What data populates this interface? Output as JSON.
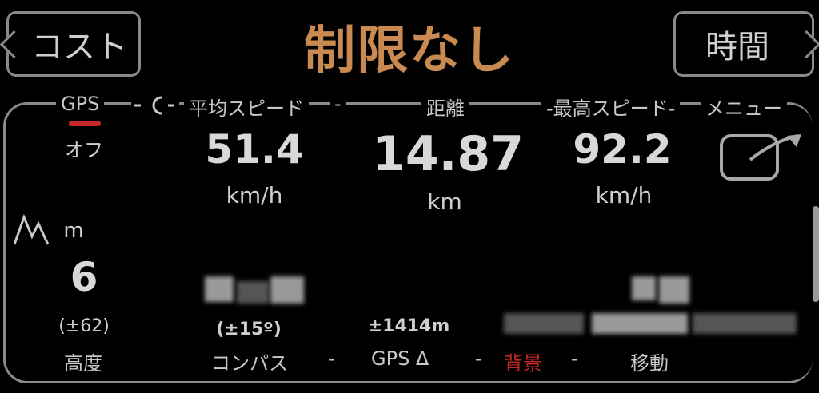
{
  "header": {
    "left_button": "コスト",
    "title": "制限なし",
    "right_button": "時間"
  },
  "top_labels": {
    "gps": "GPS",
    "gps_status": "オフ",
    "avg_speed": "平均スピード",
    "distance": "距離",
    "max_speed": "-最高スピード-",
    "menu": "メニュー"
  },
  "stats": {
    "avg_speed_value": "51.4",
    "avg_speed_unit": "km/h",
    "distance_value": "14.87",
    "distance_unit": "km",
    "max_speed_value": "92.2",
    "max_speed_unit": "km/h"
  },
  "altitude": {
    "unit": "m",
    "value": "6",
    "accuracy": "(±62)",
    "label": "高度"
  },
  "compass": {
    "accuracy": "(±15º)",
    "label": "コンパス"
  },
  "gps_delta": {
    "value": "±1414m",
    "label": "GPS Δ"
  },
  "bottom_labels": {
    "background": "背景",
    "move": "移動"
  },
  "colors": {
    "accent": "#c98a52",
    "gps_indicator": "#c62828",
    "background_label": "#c62828"
  },
  "icons": [
    "moon-icon",
    "mountain-icon",
    "share-arrow-icon"
  ]
}
